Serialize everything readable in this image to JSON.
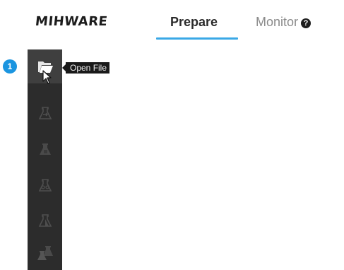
{
  "brand": {
    "name": "MIHWARE"
  },
  "tabs": [
    {
      "label": "Prepare",
      "active": true
    },
    {
      "label": "Monitor",
      "active": false,
      "help_glyph": "?"
    }
  ],
  "step_badge": "1",
  "toolbar": {
    "items": [
      {
        "icon": "open-file-icon",
        "active": true
      },
      {
        "icon": "flask-move-icon",
        "active": false
      },
      {
        "icon": "flask-icon",
        "active": false
      },
      {
        "icon": "flask-link-icon",
        "active": false
      },
      {
        "icon": "flask-half-icon",
        "active": false
      },
      {
        "icon": "flask-stack-icon",
        "active": false
      }
    ]
  },
  "tooltip": {
    "text": "Open File"
  },
  "colors": {
    "accent": "#3aa8e6",
    "badge": "#1b95e0",
    "toolbar_bg": "#2c2c2c",
    "toolbar_active": "#3f3f3f"
  }
}
